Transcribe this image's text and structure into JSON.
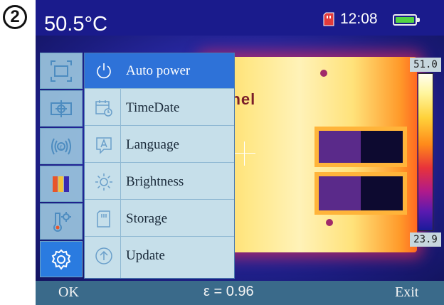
{
  "step_badge": "2",
  "status": {
    "temperature": "50.5°C",
    "time": "12:08",
    "battery_color": "#52d443",
    "sd_icon": "sd-card-icon"
  },
  "scale": {
    "max": "51.0",
    "min": "23.9"
  },
  "scene": {
    "brand": "ōnel"
  },
  "tools": [
    {
      "icon": "frame-icon"
    },
    {
      "icon": "center-point-icon"
    },
    {
      "icon": "emissivity-icon"
    },
    {
      "icon": "palette-icon"
    },
    {
      "icon": "thermometer-settings-icon"
    },
    {
      "icon": "gear-icon",
      "active": true
    }
  ],
  "menu": {
    "items": [
      {
        "label": "Auto power",
        "icon": "power-icon",
        "selected": true
      },
      {
        "label": "TimeDate",
        "icon": "calendar-clock-icon"
      },
      {
        "label": "Language",
        "icon": "language-icon"
      },
      {
        "label": "Brightness",
        "icon": "sun-icon"
      },
      {
        "label": "Storage",
        "icon": "storage-card-icon"
      },
      {
        "label": "Update",
        "icon": "update-arrow-icon"
      }
    ]
  },
  "bottom": {
    "ok": "OK",
    "emissivity": "ε = 0.96",
    "exit": "Exit"
  },
  "colors": {
    "selected": "#2e72d8",
    "menu_bg": "#c6dfea",
    "bottom_bar": "#3a6a8a",
    "top_bar": "#1a1b8c"
  }
}
